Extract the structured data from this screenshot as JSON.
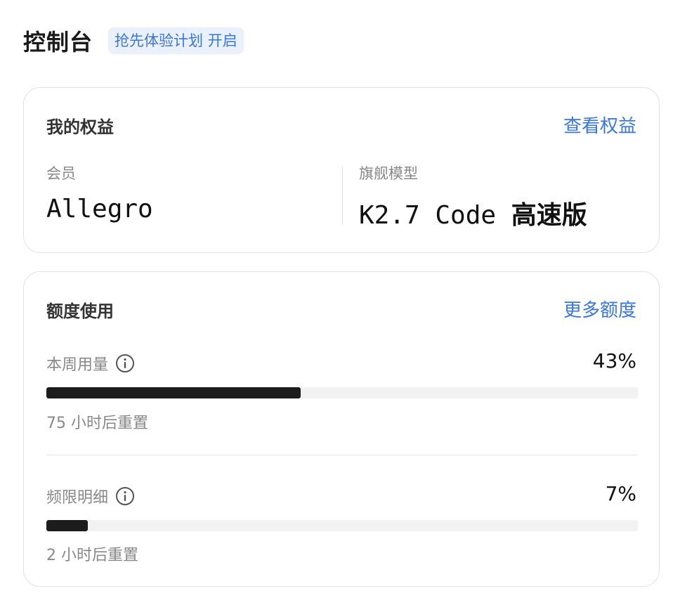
{
  "header": {
    "title": "控制台",
    "badge": "抢先体验计划 开启"
  },
  "benefits": {
    "title": "我的权益",
    "link": "查看权益",
    "membership_label": "会员",
    "membership_value": "Allegro",
    "model_label": "旗舰模型",
    "model_value_prefix": "K2.7 Code ",
    "model_value_suffix": "高速版"
  },
  "quota": {
    "title": "额度使用",
    "link": "更多额度",
    "weekly": {
      "label": "本周用量",
      "percent_text": "43%",
      "fraction": 0.43,
      "reset": "75 小时后重置"
    },
    "rate": {
      "label": "频限明细",
      "percent_text": "7%",
      "fraction": 0.07,
      "reset": "2 小时后重置"
    }
  },
  "colors": {
    "accent": "#3b76dd",
    "bar_fill": "#1c1c1d",
    "bar_track": "#f2f2f3"
  },
  "icons": {
    "info": "info-circle-icon"
  }
}
